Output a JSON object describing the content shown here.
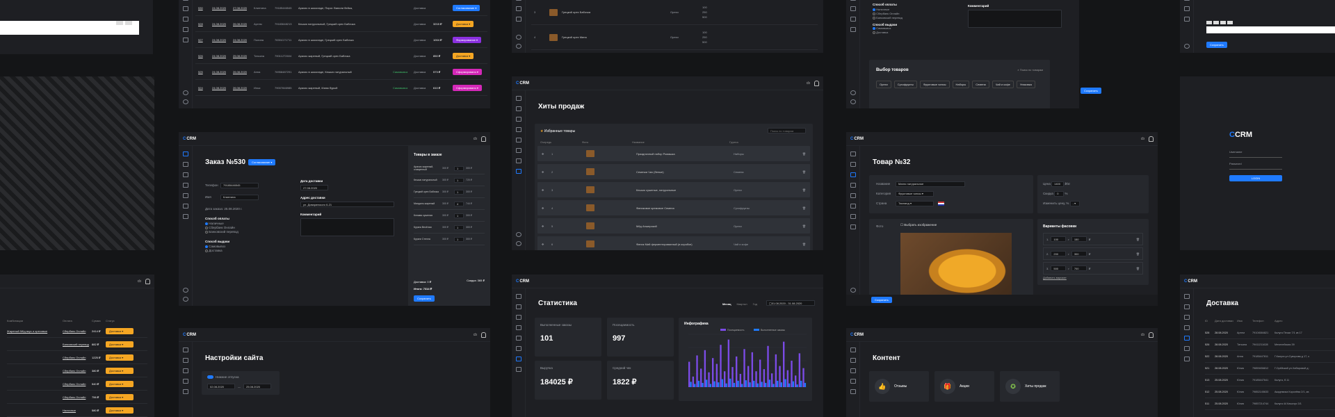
{
  "brand": {
    "logo": "CRM",
    "user_short": "cb"
  },
  "colors": {
    "accent": "#1f7aff",
    "orange": "#f5a623",
    "purple": "#8b31e0",
    "pink": "#d428b8"
  },
  "orders_top": {
    "rows": [
      {
        "id": "530",
        "date1": "24.08.2020",
        "date2": "27.08.2020",
        "name": "Клинтина",
        "phone": "79185446545",
        "desc": "Арахис в шоколаде, Пирог. Ванили бейка,",
        "delivery": "Доставка",
        "status": "Согласование"
      },
      {
        "id": "528",
        "date1": "24.08.2020",
        "date2": "26.08.2020",
        "name": "Артем",
        "phone": "79183648213",
        "desc": "Кешью натуральный, Грецкий орех Бабочка",
        "delivery": "Доставка",
        "sum": "3215 ₽",
        "status": "Доставка"
      },
      {
        "id": "527",
        "date1": "24.08.2020",
        "date2": "24.08.2020",
        "name": "Полина",
        "phone": "78304171711",
        "desc": "Арахис в шоколаде, Грецкий орех Бабочка",
        "delivery": "Доставка",
        "sum": "1004 ₽",
        "status": "Формирование"
      },
      {
        "id": "526",
        "date1": "24.08.2020",
        "date2": "25.08.2020",
        "name": "Татьяна",
        "phone": "79011272604",
        "desc": "Арахис жареный, Грецкий орех Бабочка",
        "delivery": "Доставка",
        "sum": "850 ₽",
        "status": "Доставка"
      },
      {
        "id": "525",
        "date1": "24.08.2020",
        "date2": "26.08.2020",
        "name": "Анна",
        "phone": "76958487291",
        "desc": "Арахис в шоколаде, Кешью натуральный",
        "pay": "Самовывоз",
        "delivery": "Доставка",
        "sum": "573 ₽",
        "status": "Сформировано"
      },
      {
        "id": "524",
        "date1": "24.08.2020",
        "date2": "26.08.2020",
        "name": "Илья",
        "phone": "79007846985",
        "desc": "Арахис жареный, Изюм бурый",
        "pay": "Самовывоз",
        "delivery": "Доставка",
        "sum": "610 ₽",
        "status": "Сформировано"
      }
    ]
  },
  "order": {
    "title": "Заказ №530",
    "status": "Согласование",
    "phone_label": "Телефон",
    "phone": "79185446545",
    "name_label": "Имя",
    "name": "Клинтина",
    "created_label": "Дата заказа",
    "created": "25.08.2020 г.",
    "delivery_date_label": "Дата доставки",
    "delivery_date": "27.08.2020",
    "address_label": "Адрес доставки",
    "address": "ул. Доваринского 6-21",
    "comment_label": "Комментарий",
    "payment_label": "Способ оплаты",
    "payment_options": [
      "Наличные",
      "Сбербанк Онлайн",
      "Банковский перевод"
    ],
    "issue_label": "Способ выдачи",
    "issue_options": [
      "Самовывоз",
      "Доставка"
    ],
    "items_title": "Товары в заказе",
    "items": [
      {
        "name": "Арахис жареный, очищенный",
        "price": "300 ₽",
        "qty": "1",
        "sum": "300 ₽"
      },
      {
        "name": "Кешью натуральный",
        "price": "300 ₽",
        "qty": "1",
        "sum": "720 ₽"
      },
      {
        "name": "Грецкий орех Бабочка",
        "price": "300 ₽",
        "qty": "1",
        "sum": "300 ₽"
      },
      {
        "name": "Миндаль жареный",
        "price": "300 ₽",
        "qty": "4",
        "sum": "744 ₽"
      },
      {
        "name": "Клюква сушеная",
        "price": "300 ₽",
        "qty": "1",
        "sum": "300 ₽"
      },
      {
        "name": "Курага Весёлая",
        "price": "300 ₽",
        "qty": "1",
        "sum": "300 ₽"
      },
      {
        "name": "Кураги Стелла",
        "price": "300 ₽",
        "qty": "1",
        "sum": "300 ₽"
      }
    ],
    "delivery_sum": "Доставка: 0 ₽",
    "discount": "Скидка: 365 ₽",
    "total": "Итого: 7314 ₽",
    "save": "Сохранить"
  },
  "hits": {
    "title": "Хиты продаж",
    "tab": "Избранные товары",
    "search_placeholder": "Поиск по товарам",
    "cols": [
      "Очередь",
      "Фото",
      "Название",
      "Группа"
    ],
    "rows": [
      {
        "n": "1",
        "name": "Праздничный набор Ромашка",
        "group": "Наборы"
      },
      {
        "n": "2",
        "name": "Семечки Чач (белые)",
        "group": "Семена"
      },
      {
        "n": "3",
        "name": "Кешью сушеные, натуральные",
        "group": "Орехи"
      },
      {
        "n": "4",
        "name": "Финиковое кремовое Семена",
        "group": "Сухофрукты"
      },
      {
        "n": "5",
        "name": "Мёд Апшерский",
        "group": "Орехи"
      },
      {
        "n": "6",
        "name": "Финик Мий ферментированный (в коробке)",
        "group": "Чай и кофе"
      }
    ],
    "top_rows": [
      {
        "n": "3",
        "name": "Грецкий орех Бабочка",
        "group": "Орехи",
        "w1": "100",
        "w2": "250",
        "w3": "500"
      },
      {
        "n": "4",
        "name": "Грецкий орех Мина",
        "group": "Орехи",
        "w1": "100",
        "w2": "250",
        "w3": "500"
      }
    ]
  },
  "stats": {
    "title": "Статистика",
    "periods": [
      "Месяц",
      "Квартал",
      "Год"
    ],
    "range": "01.08.2020 - 31.08.2020",
    "kpis": [
      {
        "label": "Выполненные заказы",
        "value": "101"
      },
      {
        "label": "Посещаемость",
        "value": "997"
      },
      {
        "label": "Выручка",
        "value": "184025 ₽"
      },
      {
        "label": "Средний чек",
        "value": "1822 ₽"
      }
    ],
    "infographic": "Инфографика"
  },
  "chart_data": {
    "type": "bar",
    "title": "Инфографика",
    "series": [
      {
        "name": "Посещаемость",
        "values": [
          48,
          20,
          60,
          35,
          70,
          28,
          55,
          44,
          80,
          30,
          90,
          38,
          58,
          25,
          72,
          40,
          66,
          30,
          52,
          34,
          78,
          26,
          62,
          40,
          86,
          32,
          50,
          22,
          64,
          36
        ]
      },
      {
        "name": "Выполненные заказы",
        "values": [
          10,
          6,
          12,
          8,
          14,
          6,
          11,
          9,
          15,
          7,
          16,
          8,
          12,
          6,
          13,
          9,
          12,
          7,
          10,
          8,
          14,
          6,
          12,
          9,
          15,
          7,
          11,
          5,
          12,
          8
        ]
      }
    ],
    "ylim": [
      0,
      100
    ]
  },
  "settings": {
    "title": "Настройки сайта",
    "toggle": "Нижние отпуска",
    "from": "02.08.2020",
    "to": "25.08.2020"
  },
  "product": {
    "title": "Товар №32",
    "name_label": "Название",
    "name": "Манго натуральное",
    "cat_label": "Категория",
    "cat": "Фруктовые чипсы",
    "country_label": "Страна",
    "country": "Таиланд",
    "price_label": "Цена",
    "price": "1400",
    "unit": "₽/кг",
    "discount_label": "Скидка",
    "discount": "0",
    "discount_unit": "%",
    "change_label": "Изменить цену, %",
    "photo_label": "Фото",
    "photo_btn": "Выбрать изображение",
    "variants_title": "Варианты фасовки",
    "variants": [
      {
        "n": "1",
        "w": "100",
        "p": "150"
      },
      {
        "n": "2",
        "w": "200",
        "p": "300"
      },
      {
        "n": "3",
        "w": "500",
        "p": "700"
      }
    ],
    "add_variant": "Добавить вариант",
    "save": "Сохранить"
  },
  "content": {
    "title": "Контент",
    "items": [
      {
        "label": "Отзывы"
      },
      {
        "label": "Акции"
      },
      {
        "label": "Хиты продаж"
      }
    ]
  },
  "goods_pick": {
    "payment_label": "Способ оплаты",
    "payment_options": [
      "Наличные",
      "Сбербанк Онлайн",
      "Банковский перевод"
    ],
    "issue_label": "Способ выдачи",
    "issue_options": [
      "Самовывоз",
      "Доставка"
    ],
    "comment_label": "Комментарий",
    "title": "Выбор товаров",
    "search": "Поиск по товарам",
    "chips": [
      "Орехи",
      "Сухофрукты",
      "Фруктовые чипсы",
      "Наборы",
      "Семена",
      "Чай и кофе",
      "Упаковка"
    ],
    "save": "Сохранить"
  },
  "login": {
    "logo": "CRM",
    "login_label": "Username",
    "password_label": "Password",
    "button": "LOGIN",
    "save": "Сохранить"
  },
  "delivery": {
    "title": "Доставка",
    "cols": [
      "ID",
      "Дата доставки",
      "Имя",
      "Телефон",
      "Адрес"
    ],
    "rows": [
      {
        "id": "528",
        "date": "28.08.2020",
        "name": "Артем",
        "phone": "79104584821",
        "addr": "Калуга Пески 7/1 кв 17"
      },
      {
        "id": "526",
        "date": "28.08.2020",
        "name": "Татьяна",
        "phone": "79411211628",
        "addr": "Мечелейская 39"
      },
      {
        "id": "522",
        "date": "28.08.2020",
        "name": "Анна",
        "phone": "79185447811",
        "addr": "Г.Калуга ул.Суворова д 17, кв.38"
      },
      {
        "id": "521",
        "date": "28.08.2020",
        "name": "Юлия",
        "phone": "79859456812",
        "addr": "Г.Орёйский ул.Хабаровой д 22"
      },
      {
        "id": "513",
        "date": "25.08.2020",
        "name": "Юлия",
        "phone": "79185447641",
        "addr": "Калуга, б.11"
      },
      {
        "id": "512",
        "date": "25.08.2020",
        "name": "Юлия",
        "phone": "79852145633",
        "addr": "Академика Королёва 2/1, кв.15"
      },
      {
        "id": "511",
        "date": "25.08.2020",
        "name": "Юлия",
        "phone": "79857214744",
        "addr": "Калуга 44 Качалус 3/1"
      }
    ]
  },
  "left_orders": {
    "cols": [
      "Комбинации",
      "Оплата",
      "Сумма",
      "Статус"
    ],
    "rows": [
      {
        "desc": "Жареный Мёд вкус и ореховые",
        "pay": "Сбербанк Онлайн",
        "sum": "2414 ₽",
        "status": "Доставка"
      },
      {
        "desc": "",
        "pay": "Банковский перевод",
        "sum": "882 ₽",
        "status": "Доставка"
      },
      {
        "desc": "",
        "pay": "Сбербанк Онлайн",
        "sum": "1225 ₽",
        "status": "Доставка"
      },
      {
        "desc": "",
        "pay": "Сбербанк Онлайн",
        "sum": "380 ₽",
        "status": "Доставка"
      },
      {
        "desc": "",
        "pay": "Сбербанк Онлайн",
        "sum": "540 ₽",
        "status": "Доставка"
      },
      {
        "desc": "",
        "pay": "Сбербанк Онлайн",
        "sum": "756 ₽",
        "status": "Доставка"
      },
      {
        "desc": "",
        "pay": "Наличные",
        "sum": "580 ₽",
        "status": "Доставка"
      }
    ]
  }
}
